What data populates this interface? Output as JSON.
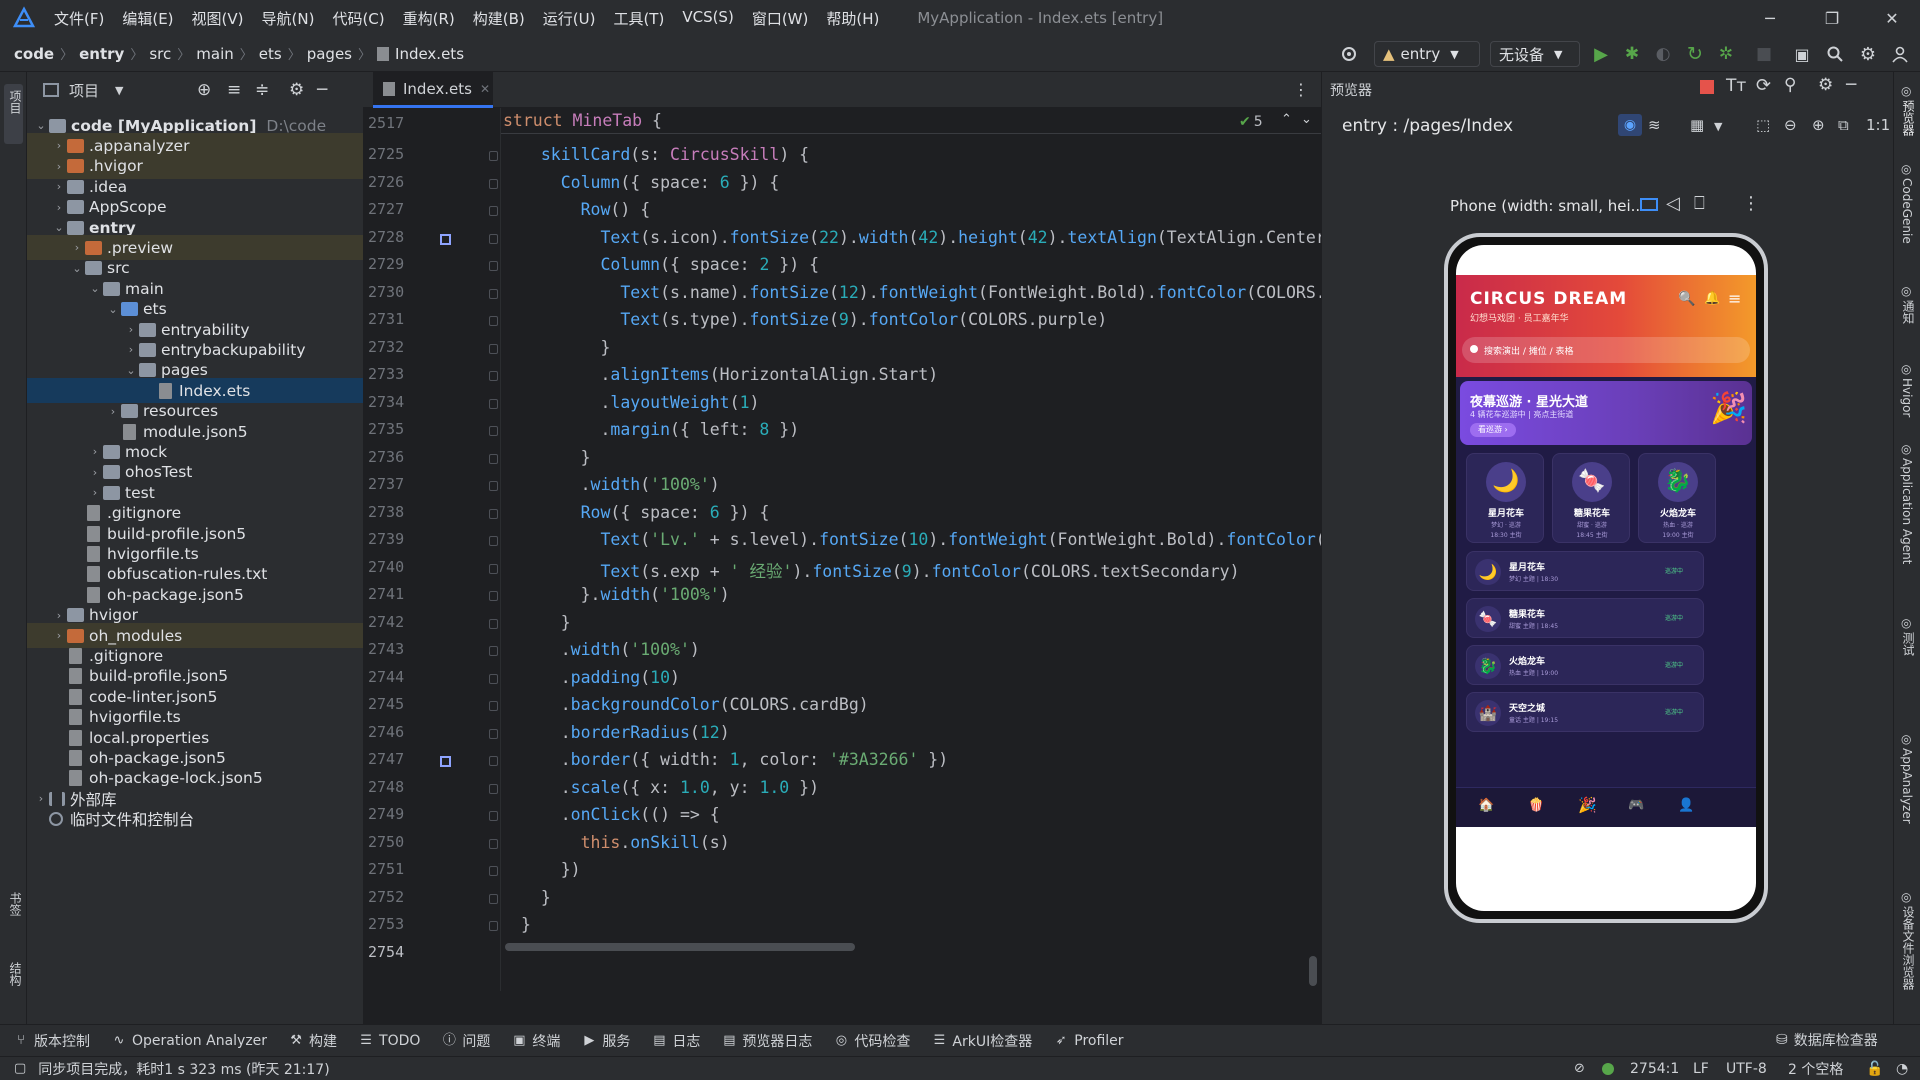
{
  "menu": {
    "items": [
      "文件(F)",
      "编辑(E)",
      "视图(V)",
      "导航(N)",
      "代码(C)",
      "重构(R)",
      "构建(B)",
      "运行(U)",
      "工具(T)",
      "VCS(S)",
      "窗口(W)",
      "帮助(H)"
    ],
    "window_title": "MyApplication - Index.ets [entry]"
  },
  "breadcrumb": [
    "code",
    "entry",
    "src",
    "main",
    "ets",
    "pages",
    "Index.ets"
  ],
  "toolbar": {
    "module_combo": "entry",
    "device_combo": "无设备"
  },
  "left_strip": {
    "project_label": "项目",
    "bookmarks_label": "书签",
    "structure_label": "结构"
  },
  "project_panel": {
    "title": "项目",
    "tree": [
      {
        "depth": 0,
        "arrow": "open",
        "icon": "folder",
        "name": "code [MyApplication]",
        "path": "D:\\code",
        "bold": true,
        "hl": false
      },
      {
        "depth": 1,
        "arrow": "closed",
        "icon": "folder-o",
        "name": ".appanalyzer",
        "hl": true
      },
      {
        "depth": 1,
        "arrow": "closed",
        "icon": "folder-o",
        "name": ".hvigor",
        "hl": true
      },
      {
        "depth": 1,
        "arrow": "closed",
        "icon": "folder",
        "name": ".idea",
        "hl": false
      },
      {
        "depth": 1,
        "arrow": "closed",
        "icon": "folder",
        "name": "AppScope",
        "hl": false
      },
      {
        "depth": 1,
        "arrow": "open",
        "icon": "folder",
        "name": "entry",
        "bold": true,
        "hl": false
      },
      {
        "depth": 2,
        "arrow": "closed",
        "icon": "folder-o",
        "name": ".preview",
        "hl": true
      },
      {
        "depth": 2,
        "arrow": "open",
        "icon": "folder",
        "name": "src",
        "hl": false
      },
      {
        "depth": 3,
        "arrow": "open",
        "icon": "folder",
        "name": "main",
        "hl": false
      },
      {
        "depth": 4,
        "arrow": "open",
        "icon": "folder-b",
        "name": "ets",
        "hl": false
      },
      {
        "depth": 5,
        "arrow": "closed",
        "icon": "folder",
        "name": "entryability",
        "hl": false
      },
      {
        "depth": 5,
        "arrow": "closed",
        "icon": "folder",
        "name": "entrybackupability",
        "hl": false
      },
      {
        "depth": 5,
        "arrow": "open",
        "icon": "folder",
        "name": "pages",
        "hl": false
      },
      {
        "depth": 6,
        "arrow": "none",
        "icon": "file",
        "name": "Index.ets",
        "sel": true
      },
      {
        "depth": 4,
        "arrow": "closed",
        "icon": "folder",
        "name": "resources",
        "hl": false
      },
      {
        "depth": 4,
        "arrow": "none",
        "icon": "file",
        "name": "module.json5",
        "hl": false
      },
      {
        "depth": 3,
        "arrow": "closed",
        "icon": "folder",
        "name": "mock",
        "hl": false
      },
      {
        "depth": 3,
        "arrow": "closed",
        "icon": "folder",
        "name": "ohosTest",
        "hl": false
      },
      {
        "depth": 3,
        "arrow": "closed",
        "icon": "folder",
        "name": "test",
        "hl": false
      },
      {
        "depth": 2,
        "arrow": "none",
        "icon": "file",
        "name": ".gitignore",
        "hl": false
      },
      {
        "depth": 2,
        "arrow": "none",
        "icon": "file",
        "name": "build-profile.json5",
        "hl": false
      },
      {
        "depth": 2,
        "arrow": "none",
        "icon": "file",
        "name": "hvigorfile.ts",
        "hl": false
      },
      {
        "depth": 2,
        "arrow": "none",
        "icon": "file",
        "name": "obfuscation-rules.txt",
        "hl": false
      },
      {
        "depth": 2,
        "arrow": "none",
        "icon": "file",
        "name": "oh-package.json5",
        "hl": false
      },
      {
        "depth": 1,
        "arrow": "closed",
        "icon": "folder",
        "name": "hvigor",
        "hl": false
      },
      {
        "depth": 1,
        "arrow": "closed",
        "icon": "folder-o",
        "name": "oh_modules",
        "hl": true
      },
      {
        "depth": 1,
        "arrow": "none",
        "icon": "file",
        "name": ".gitignore",
        "hl": false
      },
      {
        "depth": 1,
        "arrow": "none",
        "icon": "file",
        "name": "build-profile.json5",
        "hl": false
      },
      {
        "depth": 1,
        "arrow": "none",
        "icon": "file",
        "name": "code-linter.json5",
        "hl": false
      },
      {
        "depth": 1,
        "arrow": "none",
        "icon": "file",
        "name": "hvigorfile.ts",
        "hl": false
      },
      {
        "depth": 1,
        "arrow": "none",
        "icon": "file",
        "name": "local.properties",
        "hl": false
      },
      {
        "depth": 1,
        "arrow": "none",
        "icon": "file",
        "name": "oh-package.json5",
        "hl": false
      },
      {
        "depth": 1,
        "arrow": "none",
        "icon": "file",
        "name": "oh-package-lock.json5",
        "hl": false
      },
      {
        "depth": 0,
        "arrow": "closed",
        "icon": "lib",
        "name": "外部库",
        "hl": false
      },
      {
        "depth": 0,
        "arrow": "none",
        "icon": "scratch",
        "name": "临时文件和控制台",
        "hl": false
      }
    ]
  },
  "editor": {
    "tab_label": "Index.ets",
    "sticky_line_no": "2517",
    "sticky": [
      [
        "k",
        "struct "
      ],
      [
        "ty",
        "MineTab "
      ],
      [
        "p",
        "{"
      ]
    ],
    "problems_count": "5",
    "line_numbers": [
      "2725",
      "2726",
      "2727",
      "2728",
      "2729",
      "2730",
      "2731",
      "2732",
      "2733",
      "2734",
      "2735",
      "2736",
      "2737",
      "2738",
      "2739",
      "2740",
      "2741",
      "2742",
      "2743",
      "2744",
      "2745",
      "2746",
      "2747",
      "2748",
      "2749",
      "2750",
      "2751",
      "2752",
      "2753",
      "2754"
    ],
    "lines": [
      [
        [
          "p",
          "  "
        ],
        [
          "f",
          "skillCard"
        ],
        [
          "p",
          "(s: "
        ],
        [
          "ty",
          "CircusSkill"
        ],
        [
          "p",
          ") {"
        ]
      ],
      [
        [
          "p",
          "    "
        ],
        [
          "f",
          "Column"
        ],
        [
          "p",
          "({ space: "
        ],
        [
          "n",
          "6"
        ],
        [
          "p",
          " }) {"
        ]
      ],
      [
        [
          "p",
          "      "
        ],
        [
          "f",
          "Row"
        ],
        [
          "p",
          "() {"
        ]
      ],
      [
        [
          "p",
          "        "
        ],
        [
          "f",
          "Text"
        ],
        [
          "p",
          "(s.icon)."
        ],
        [
          "f",
          "fontSize"
        ],
        [
          "p",
          "("
        ],
        [
          "n",
          "22"
        ],
        [
          "p",
          ")."
        ],
        [
          "f",
          "width"
        ],
        [
          "p",
          "("
        ],
        [
          "n",
          "42"
        ],
        [
          "p",
          ")."
        ],
        [
          "f",
          "height"
        ],
        [
          "p",
          "("
        ],
        [
          "n",
          "42"
        ],
        [
          "p",
          ")."
        ],
        [
          "f",
          "textAlign"
        ],
        [
          "p",
          "(TextAlign.Center)"
        ]
      ],
      [
        [
          "p",
          "        "
        ],
        [
          "f",
          "Column"
        ],
        [
          "p",
          "({ space: "
        ],
        [
          "n",
          "2"
        ],
        [
          "p",
          " }) {"
        ]
      ],
      [
        [
          "p",
          "          "
        ],
        [
          "f",
          "Text"
        ],
        [
          "p",
          "(s.name)."
        ],
        [
          "f",
          "fontSize"
        ],
        [
          "p",
          "("
        ],
        [
          "n",
          "12"
        ],
        [
          "p",
          ")."
        ],
        [
          "f",
          "fontWeight"
        ],
        [
          "p",
          "(FontWeight.Bold)."
        ],
        [
          "f",
          "fontColor"
        ],
        [
          "p",
          "(COLORS.w"
        ]
      ],
      [
        [
          "p",
          "          "
        ],
        [
          "f",
          "Text"
        ],
        [
          "p",
          "(s.type)."
        ],
        [
          "f",
          "fontSize"
        ],
        [
          "p",
          "("
        ],
        [
          "n",
          "9"
        ],
        [
          "p",
          ")."
        ],
        [
          "f",
          "fontColor"
        ],
        [
          "p",
          "(COLORS.purple)"
        ]
      ],
      [
        [
          "p",
          "        }"
        ]
      ],
      [
        [
          "p",
          "        ."
        ],
        [
          "f",
          "alignItems"
        ],
        [
          "p",
          "(HorizontalAlign.Start)"
        ]
      ],
      [
        [
          "p",
          "        ."
        ],
        [
          "f",
          "layoutWeight"
        ],
        [
          "p",
          "("
        ],
        [
          "n",
          "1"
        ],
        [
          "p",
          ")"
        ]
      ],
      [
        [
          "p",
          "        ."
        ],
        [
          "f",
          "margin"
        ],
        [
          "p",
          "({ left: "
        ],
        [
          "n",
          "8"
        ],
        [
          "p",
          " })"
        ]
      ],
      [
        [
          "p",
          "      }"
        ]
      ],
      [
        [
          "p",
          "      ."
        ],
        [
          "f",
          "width"
        ],
        [
          "p",
          "("
        ],
        [
          "s",
          "'100%'"
        ],
        [
          "p",
          ")"
        ]
      ],
      [
        [
          "p",
          "      "
        ],
        [
          "f",
          "Row"
        ],
        [
          "p",
          "({ space: "
        ],
        [
          "n",
          "6"
        ],
        [
          "p",
          " }) {"
        ]
      ],
      [
        [
          "p",
          "        "
        ],
        [
          "f",
          "Text"
        ],
        [
          "p",
          "("
        ],
        [
          "s",
          "'Lv.'"
        ],
        [
          "p",
          " + s.level)."
        ],
        [
          "f",
          "fontSize"
        ],
        [
          "p",
          "("
        ],
        [
          "n",
          "10"
        ],
        [
          "p",
          ")."
        ],
        [
          "f",
          "fontWeight"
        ],
        [
          "p",
          "(FontWeight.Bold)."
        ],
        [
          "f",
          "fontColor"
        ],
        [
          "p",
          "(C"
        ]
      ],
      [
        [
          "p",
          "        "
        ],
        [
          "f",
          "Text"
        ],
        [
          "p",
          "(s.exp + "
        ],
        [
          "s",
          "' 经验'"
        ],
        [
          "p",
          ")."
        ],
        [
          "f",
          "fontSize"
        ],
        [
          "p",
          "("
        ],
        [
          "n",
          "9"
        ],
        [
          "p",
          ")."
        ],
        [
          "f",
          "fontColor"
        ],
        [
          "p",
          "(COLORS.textSecondary)"
        ]
      ],
      [
        [
          "p",
          "      }."
        ],
        [
          "f",
          "width"
        ],
        [
          "p",
          "("
        ],
        [
          "s",
          "'100%'"
        ],
        [
          "p",
          ")"
        ]
      ],
      [
        [
          "p",
          "    }"
        ]
      ],
      [
        [
          "p",
          "    ."
        ],
        [
          "f",
          "width"
        ],
        [
          "p",
          "("
        ],
        [
          "s",
          "'100%'"
        ],
        [
          "p",
          ")"
        ]
      ],
      [
        [
          "p",
          "    ."
        ],
        [
          "f",
          "padding"
        ],
        [
          "p",
          "("
        ],
        [
          "n",
          "10"
        ],
        [
          "p",
          ")"
        ]
      ],
      [
        [
          "p",
          "    ."
        ],
        [
          "f",
          "backgroundColor"
        ],
        [
          "p",
          "(COLORS.cardBg)"
        ]
      ],
      [
        [
          "p",
          "    ."
        ],
        [
          "f",
          "borderRadius"
        ],
        [
          "p",
          "("
        ],
        [
          "n",
          "12"
        ],
        [
          "p",
          ")"
        ]
      ],
      [
        [
          "p",
          "    ."
        ],
        [
          "f",
          "border"
        ],
        [
          "p",
          "({ width: "
        ],
        [
          "n",
          "1"
        ],
        [
          "p",
          ", color: "
        ],
        [
          "s",
          "'#3A3266'"
        ],
        [
          "p",
          " })"
        ]
      ],
      [
        [
          "p",
          "    ."
        ],
        [
          "f",
          "scale"
        ],
        [
          "p",
          "({ x: "
        ],
        [
          "n",
          "1.0"
        ],
        [
          "p",
          ", y: "
        ],
        [
          "n",
          "1.0"
        ],
        [
          "p",
          " })"
        ]
      ],
      [
        [
          "p",
          "    ."
        ],
        [
          "f",
          "onClick"
        ],
        [
          "p",
          "(() => {"
        ]
      ],
      [
        [
          "p",
          "      "
        ],
        [
          "k",
          "this"
        ],
        [
          "p",
          "."
        ],
        [
          "f",
          "onSkill"
        ],
        [
          "p",
          "(s)"
        ]
      ],
      [
        [
          "p",
          "    })"
        ]
      ],
      [
        [
          "p",
          "  }"
        ]
      ],
      [
        [
          "p",
          "}"
        ]
      ],
      [
        [
          "p",
          ""
        ]
      ]
    ]
  },
  "previewer": {
    "title": "预览器",
    "route": "entry : /pages/Index",
    "device_label": "Phone (width: small, hei..."
  },
  "app": {
    "brand": "CIRCUS DREAM",
    "subtitle": "幻想马戏团 · 员工嘉年华",
    "search_placeholder": "搜索演出 / 摊位 / 表格",
    "banner_title": "夜幕巡游 · 星光大道",
    "banner_sub": "4 辆花车巡游中 | 亮点主街道",
    "banner_btn": "看巡游 ›",
    "cards": [
      {
        "icon": "🌙",
        "name": "星月花车",
        "l1": "梦幻 · 巡游",
        "l2": "18:30 主街"
      },
      {
        "icon": "🍬",
        "name": "糖果花车",
        "l1": "甜蜜 · 巡游",
        "l2": "18:45 主街"
      },
      {
        "icon": "🐉",
        "name": "火焰龙车",
        "l1": "热血 · 巡游",
        "l2": "19:00 主街"
      }
    ],
    "list": [
      {
        "icon": "🌙",
        "name": "星月花车",
        "meta": "梦幻 主题 | 18:30",
        "badge": "巡游中"
      },
      {
        "icon": "🍬",
        "name": "糖果花车",
        "meta": "甜蜜 主题 | 18:45",
        "badge": "巡游中"
      },
      {
        "icon": "🐉",
        "name": "火焰龙车",
        "meta": "热血 主题 | 19:00",
        "badge": "巡游中"
      },
      {
        "icon": "🏰",
        "name": "天空之城",
        "meta": "童话 主题 | 19:15",
        "badge": "巡游中"
      }
    ]
  },
  "right_strip": [
    "预览器",
    "CodeGenie",
    "通知",
    "Hvigor",
    "Application Agent",
    "测试",
    "AppAnalyzer",
    "设备文件浏览器"
  ],
  "bottom_tools": [
    "版本控制",
    "Operation Analyzer",
    "构建",
    "TODO",
    "问题",
    "终端",
    "服务",
    "日志",
    "预览器日志",
    "代码检查",
    "ArkUI检查器",
    "Profiler"
  ],
  "bottom_right_tool": "数据库检查器",
  "status": {
    "message": "同步项目完成，耗时1 s 323 ms (昨天 21:17)",
    "position": "2754:1",
    "line_sep": "LF",
    "encoding": "UTF-8",
    "indent": "2 个空格"
  }
}
